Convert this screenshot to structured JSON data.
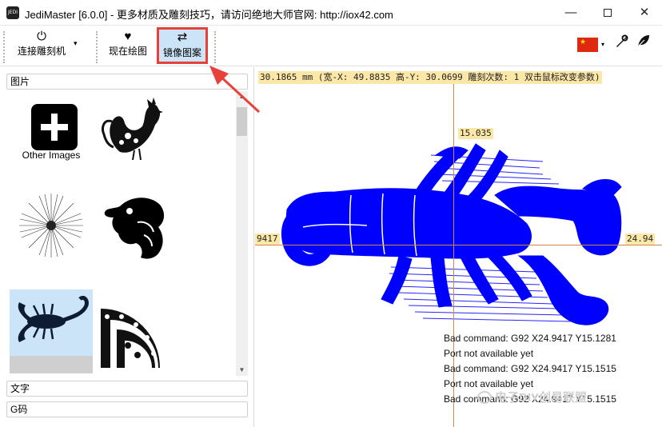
{
  "window": {
    "title": "JediMaster [6.0.0] - 更多材质及雕刻技巧，请访问绝地大师官网: http://iox42.com",
    "app_icon_text": "JEDI",
    "minimize_glyph": "—",
    "close_glyph": "✕"
  },
  "toolbar": {
    "connect_label": "连接雕刻机",
    "connect_icon": "power-icon",
    "dropdown_glyph": "▾",
    "draw_label": "现在绘图",
    "draw_icon": "heart-icon",
    "mirror_label": "镜像图案",
    "mirror_icon": "swap-arrows-icon",
    "language_flag": "china-flag-icon",
    "settings_icon": "wrench-icon",
    "leaf_icon": "leaf-icon"
  },
  "left_panel": {
    "pictures_section": "图片",
    "text_section": "文字",
    "gcode_section": "G码",
    "other_images_label": "Other Images",
    "thumbnails": [
      "other-images",
      "rooster",
      "sunburst",
      "eagle-head",
      "scorpion",
      "ornament-fan"
    ],
    "selected_thumbnail": "scorpion"
  },
  "canvas": {
    "status": "30.1865 mm  (宽-X: 49.8835  高-Y: 30.0699  雕刻次数: 1  双击鼠标改变参数)",
    "coord_top": "15.035",
    "coord_left": "9417",
    "coord_right": "24.94",
    "log_lines": [
      "Bad command: G92 X24.9417 Y15.1281",
      "Port not available yet",
      "Bad command: G92 X24.9417 Y15.1515",
      "Port not available yet",
      "Bad command: G92 X24.9417 Y15.1515"
    ],
    "engrave_color": "#0000ff",
    "crosshair_color": "#c98a4e"
  },
  "watermark": "电子DIY创易联盟"
}
